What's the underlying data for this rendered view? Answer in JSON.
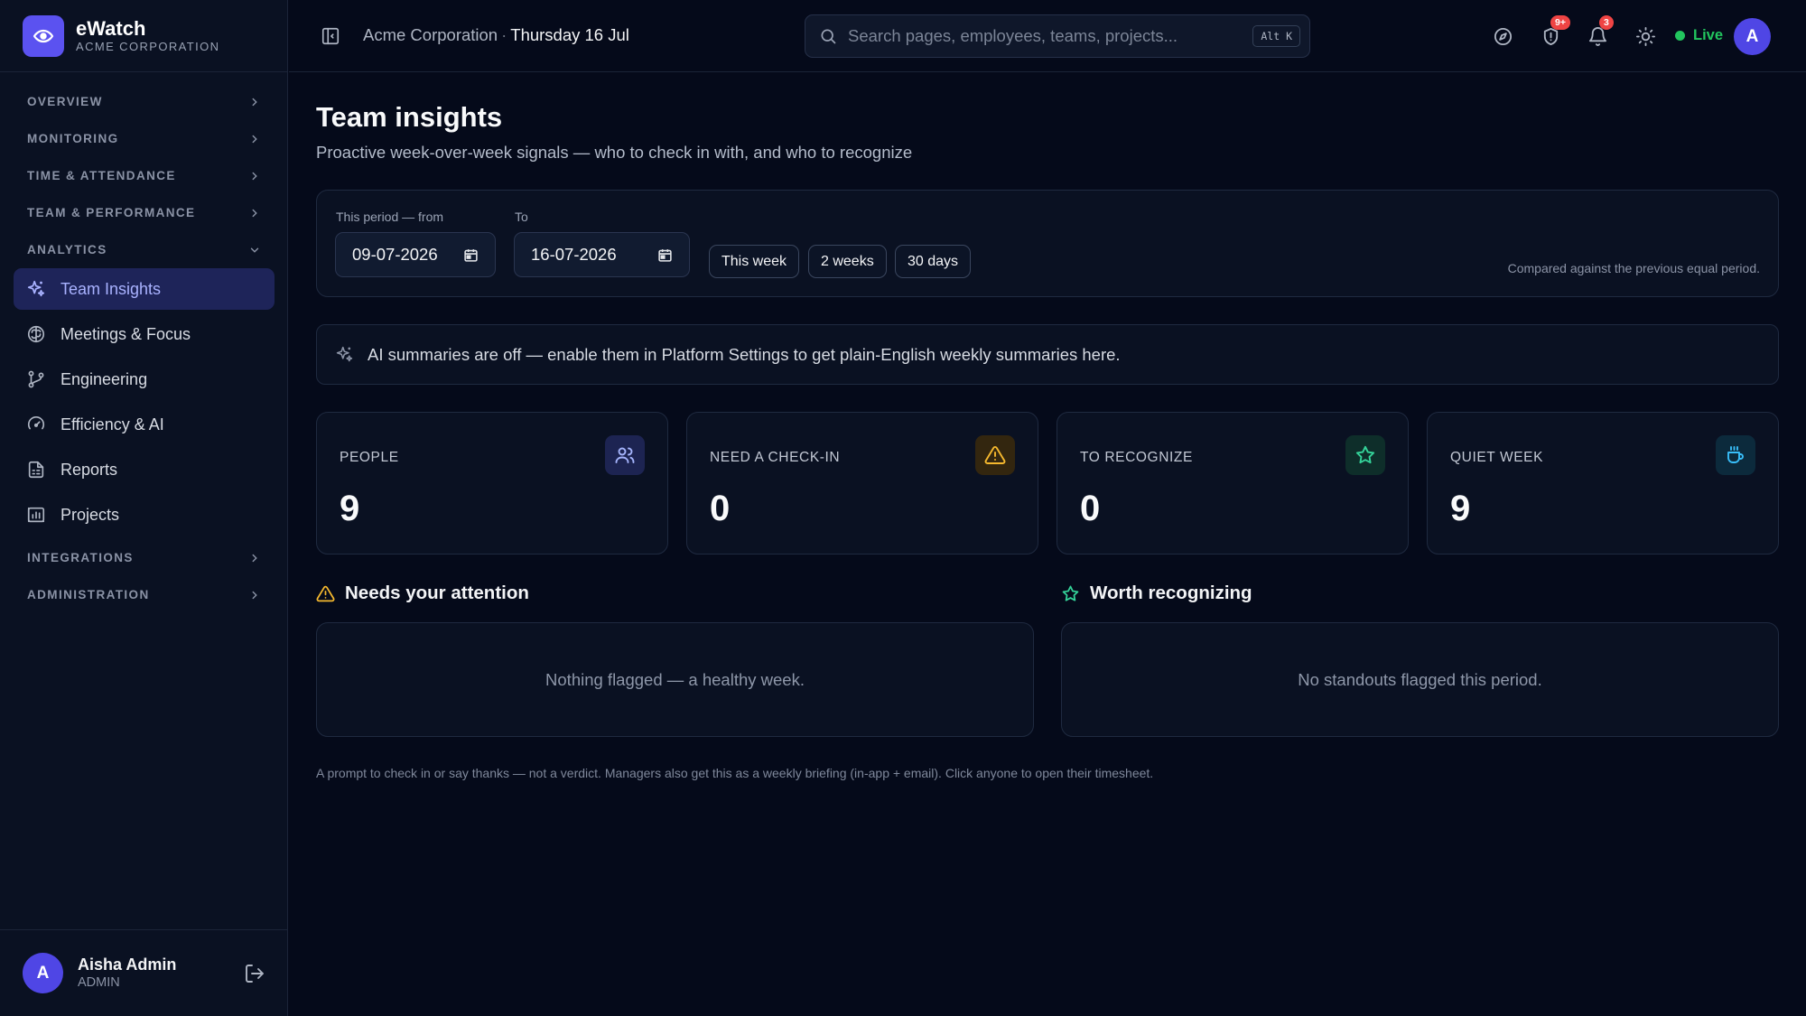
{
  "brand": {
    "name": "eWatch",
    "org": "ACME CORPORATION"
  },
  "sidebar": {
    "sections": [
      {
        "label": "OVERVIEW"
      },
      {
        "label": "MONITORING"
      },
      {
        "label": "TIME & ATTENDANCE"
      },
      {
        "label": "TEAM & PERFORMANCE"
      },
      {
        "label": "ANALYTICS"
      }
    ],
    "analytics_items": [
      {
        "label": "Team Insights",
        "icon": "sparkles-icon",
        "active": true
      },
      {
        "label": "Meetings & Focus",
        "icon": "brain-icon"
      },
      {
        "label": "Engineering",
        "icon": "git-branch-icon"
      },
      {
        "label": "Efficiency & AI",
        "icon": "gauge-icon"
      },
      {
        "label": "Reports",
        "icon": "report-icon"
      },
      {
        "label": "Projects",
        "icon": "chart-icon"
      }
    ],
    "bottom_sections": [
      {
        "label": "INTEGRATIONS"
      },
      {
        "label": "ADMINISTRATION"
      }
    ],
    "user": {
      "initial": "A",
      "name": "Aisha Admin",
      "role": "ADMIN"
    }
  },
  "topbar": {
    "org": "Acme Corporation",
    "separator": "·",
    "date": "Thursday 16 Jul",
    "search_placeholder": "Search pages, employees, teams, projects...",
    "search_shortcut": "Alt K",
    "alerts_badge": "9+",
    "notifications_badge": "3",
    "live_label": "Live",
    "avatar_initial": "A"
  },
  "page": {
    "title": "Team insights",
    "subtitle": "Proactive week-over-week signals — who to check in with, and who to recognize"
  },
  "filters": {
    "from_label": "This period — from",
    "from_value": "09-07-2026",
    "to_label": "To",
    "to_value": "16-07-2026",
    "presets": [
      "This week",
      "2 weeks",
      "30 days"
    ],
    "compare_note": "Compared against the previous equal period."
  },
  "ai_banner": "AI summaries are off — enable them in Platform Settings to get plain-English weekly summaries here.",
  "stats": [
    {
      "label": "PEOPLE",
      "value": "9",
      "icon": "users-icon"
    },
    {
      "label": "NEED A CHECK-IN",
      "value": "0",
      "icon": "warning-icon"
    },
    {
      "label": "TO RECOGNIZE",
      "value": "0",
      "icon": "star-icon"
    },
    {
      "label": "QUIET WEEK",
      "value": "9",
      "icon": "coffee-icon"
    }
  ],
  "attention": {
    "title": "Needs your attention",
    "empty": "Nothing flagged — a healthy week."
  },
  "recognize": {
    "title": "Worth recognizing",
    "empty": "No standouts flagged this period."
  },
  "footnote": "A prompt to check in or say thanks — not a verdict. Managers also get this as a weekly briefing (in-app + email). Click anyone to open their timesheet.",
  "colors": {
    "background": "#050a1a",
    "accent": "#5b52f0",
    "active_nav": "#1e2459",
    "warning": "#f5b82e",
    "success": "#22c55e",
    "badge": "#ef4444"
  }
}
